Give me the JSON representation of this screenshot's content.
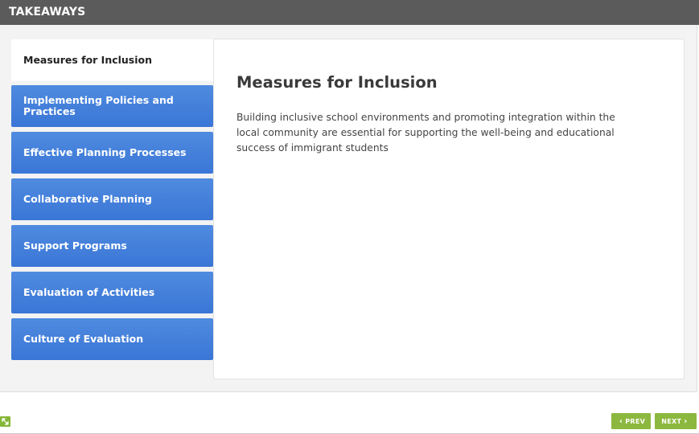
{
  "header": {
    "title": "TAKEAWAYS"
  },
  "tabs": [
    {
      "label": "Measures for Inclusion",
      "active": true
    },
    {
      "label": "Implementing Policies and Practices",
      "active": false
    },
    {
      "label": "Effective Planning Processes",
      "active": false
    },
    {
      "label": "Collaborative Planning",
      "active": false
    },
    {
      "label": "Support Programs",
      "active": false
    },
    {
      "label": "Evaluation of Activities",
      "active": false
    },
    {
      "label": "Culture of Evaluation",
      "active": false
    }
  ],
  "content": {
    "title": "Measures for Inclusion",
    "body": "Building inclusive school environments and promoting integration within the local community are essential for supporting the well-being and educational success of immigrant students"
  },
  "footer": {
    "prev_label": "PREV",
    "next_label": "NEXT",
    "prev_icon": "chevron-left-icon",
    "next_icon": "chevron-right-icon",
    "expand_icon": "expand-icon"
  },
  "colors": {
    "header_bg": "#5b5b5b",
    "tab_bg": "#3f7fdb",
    "nav_button_bg": "#8db83f"
  }
}
